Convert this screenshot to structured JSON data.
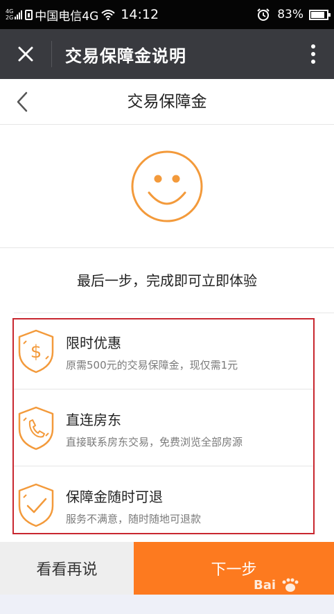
{
  "status_bar": {
    "network_types": [
      "4G",
      "2G"
    ],
    "carrier": "中国电信4G",
    "time": "14:12",
    "battery_percent": "83%",
    "icons": [
      "signal-icon",
      "sim-icon",
      "wifi-icon",
      "alarm-icon",
      "battery-icon"
    ]
  },
  "app_bar": {
    "title": "交易保障金说明",
    "icons": [
      "close-icon",
      "more-icon"
    ]
  },
  "page": {
    "title": "交易保障金",
    "back_icon": "chevron-left-icon",
    "hero_icon": "smiley-icon",
    "subtitle": "最后一步，完成即可立即体验"
  },
  "features": [
    {
      "icon": "shield-dollar-icon",
      "title": "限时优惠",
      "desc": "原需500元的交易保障金，现仅需1元"
    },
    {
      "icon": "shield-phone-icon",
      "title": "直连房东",
      "desc": "直接联系房东交易，免费浏览全部房源"
    },
    {
      "icon": "shield-check-icon",
      "title": "保障金随时可退",
      "desc": "服务不满意，随时随地可退款"
    }
  ],
  "actions": {
    "later": "看看再说",
    "next": "下一步"
  },
  "colors": {
    "accent": "#fd7a1f",
    "icon_orange": "#f39a3b",
    "app_bar": "#393a3f",
    "highlight_border": "#c8272f"
  }
}
